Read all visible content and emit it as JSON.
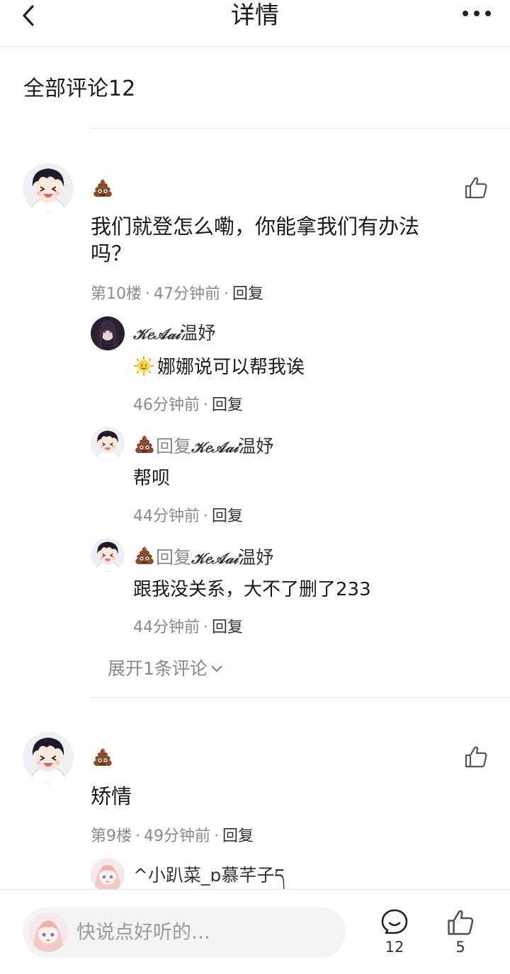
{
  "header": {
    "title": "详情",
    "back_icon": "back-chevron-icon",
    "more_icon": "more-dots-icon"
  },
  "section": {
    "title": "全部评论12"
  },
  "comments": [
    {
      "author_icon": "poop-emoji-icon",
      "text_line1": "我们就登怎么嘞，你能拿我们有办法",
      "text_line2": "吗？",
      "floor": "第10楼",
      "time": "47分钟前",
      "reply_label": "回复",
      "replies": [
        {
          "name_brand": "𝒦𝑒𝒜𝒶𝒾",
          "name_rest": "温妤",
          "text": "娜娜说可以帮我诶",
          "text_emoji": "sun-face-emoji-icon",
          "time": "46分钟前",
          "reply_label": "回复"
        },
        {
          "reply_word": "回复",
          "target_brand": "𝒦𝑒𝒜𝒶𝒾",
          "target_rest": "温妤",
          "text": "帮呗",
          "time": "44分钟前",
          "reply_label": "回复"
        },
        {
          "reply_word": "回复",
          "target_brand": "𝒦𝑒𝒜𝒶𝒾",
          "target_rest": "温妤",
          "text": "跟我没关系，大不了删了233",
          "time": "44分钟前",
          "reply_label": "回复"
        }
      ],
      "expand_label": "展开1条评论"
    },
    {
      "author_icon": "poop-emoji-icon",
      "text_line1": "矫情",
      "floor": "第9楼",
      "time": "49分钟前",
      "reply_label": "回复",
      "replies": [
        {
          "name": "^小趴菜_ɒ慕芊子ད"
        }
      ]
    }
  ],
  "bottom": {
    "input_placeholder": "快说点好听的…",
    "comment_count": "12",
    "like_count": "5",
    "comment_icon": "comment-bubble-icon",
    "like_icon": "thumbs-up-icon"
  },
  "colors": {
    "meta_gray": "#8a8a8a",
    "divider": "#ececec",
    "input_bg": "#f3f3f3"
  }
}
